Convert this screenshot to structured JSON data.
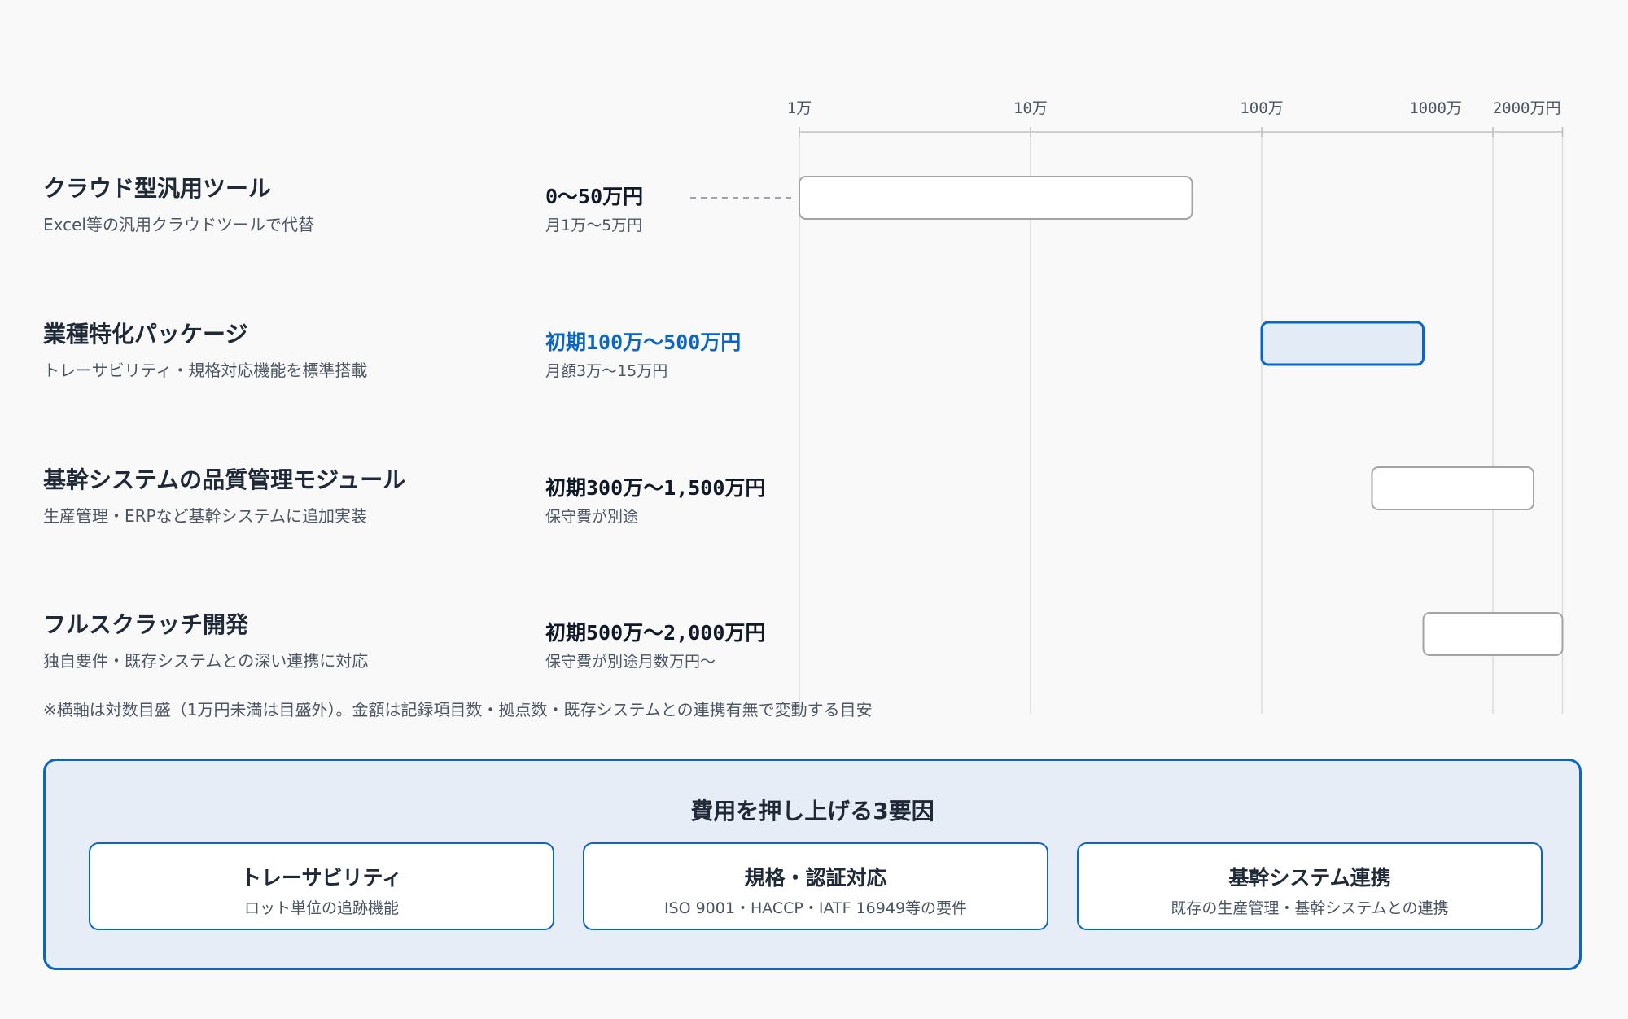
{
  "chart_data": {
    "type": "range-bar",
    "scale": "log",
    "x_unit": "万円",
    "xlim": [
      1,
      2000
    ],
    "ticks": [
      {
        "value": 1,
        "label": "1万"
      },
      {
        "value": 10,
        "label": "10万"
      },
      {
        "value": 100,
        "label": "100万"
      },
      {
        "value": 1000,
        "label": "1000万"
      },
      {
        "value": 2000,
        "label": "2000万円"
      }
    ],
    "rows": [
      {
        "title": "クラウド型汎用ツール",
        "desc": "Excel等の汎用クラウドツールで代替",
        "price": "0〜50万円",
        "note": "月1万〜5万円",
        "min": 1,
        "max": 50,
        "below_axis_min": true,
        "highlight": false
      },
      {
        "title": "業種特化パッケージ",
        "desc": "トレーサビリティ・規格対応機能を標準搭載",
        "price": "初期100万〜500万円",
        "note": "月額3万〜15万円",
        "min": 100,
        "max": 500,
        "below_axis_min": false,
        "highlight": true
      },
      {
        "title": "基幹システムの品質管理モジュール",
        "desc": "生産管理・ERPなど基幹システムに追加実装",
        "price": "初期300万〜1,500万円",
        "note": "保守費が別途",
        "min": 300,
        "max": 1500,
        "below_axis_min": false,
        "highlight": false
      },
      {
        "title": "フルスクラッチ開発",
        "desc": "独自要件・既存システムとの深い連携に対応",
        "price": "初期500万〜2,000万円",
        "note": "保守費が別途月数万円〜",
        "min": 500,
        "max": 2000,
        "below_axis_min": false,
        "highlight": false
      }
    ],
    "footnote": "※横軸は対数目盛（1万円未満は目盛外）。金額は記録項目数・拠点数・既存システムとの連携有無で変動する目安"
  },
  "factors": {
    "title": "費用を押し上げる3要因",
    "items": [
      {
        "title": "トレーサビリティ",
        "desc": "ロット単位の追跡機能"
      },
      {
        "title": "規格・認証対応",
        "desc": "ISO 9001・HACCP・IATF 16949等の要件"
      },
      {
        "title": "基幹システム連携",
        "desc": "既存の生産管理・基幹システムとの連携"
      }
    ]
  },
  "colors": {
    "accent": "#0b65c2",
    "highlight_fill": "#e3ebf6",
    "bar_stroke": "#a3a3a3",
    "grid": "#dcdcdc"
  }
}
